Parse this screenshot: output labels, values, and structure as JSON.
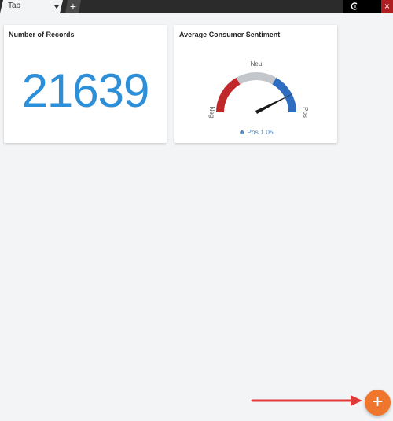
{
  "tabs": {
    "active_tab_label": "Tab",
    "add_tab_label": "+",
    "close_label": "×"
  },
  "cards": {
    "records": {
      "title": "Number of Records",
      "value": "21639"
    },
    "sentiment": {
      "title": "Average Consumer Sentiment",
      "gauge": {
        "label_neg": "Neg",
        "label_neu": "Neu",
        "label_pos": "Pos",
        "value_text": "Pos 1.05",
        "value": 1.05,
        "range": [
          -1.5,
          1.5
        ],
        "colors": {
          "neg": "#c0282a",
          "neu": "#c3c7cc",
          "pos": "#2e6dbf",
          "needle": "#1a1a1a"
        }
      }
    }
  },
  "fab": {
    "label": "+",
    "color": "#f0752d"
  },
  "annotation": {
    "arrow_color": "#e03a3a"
  }
}
